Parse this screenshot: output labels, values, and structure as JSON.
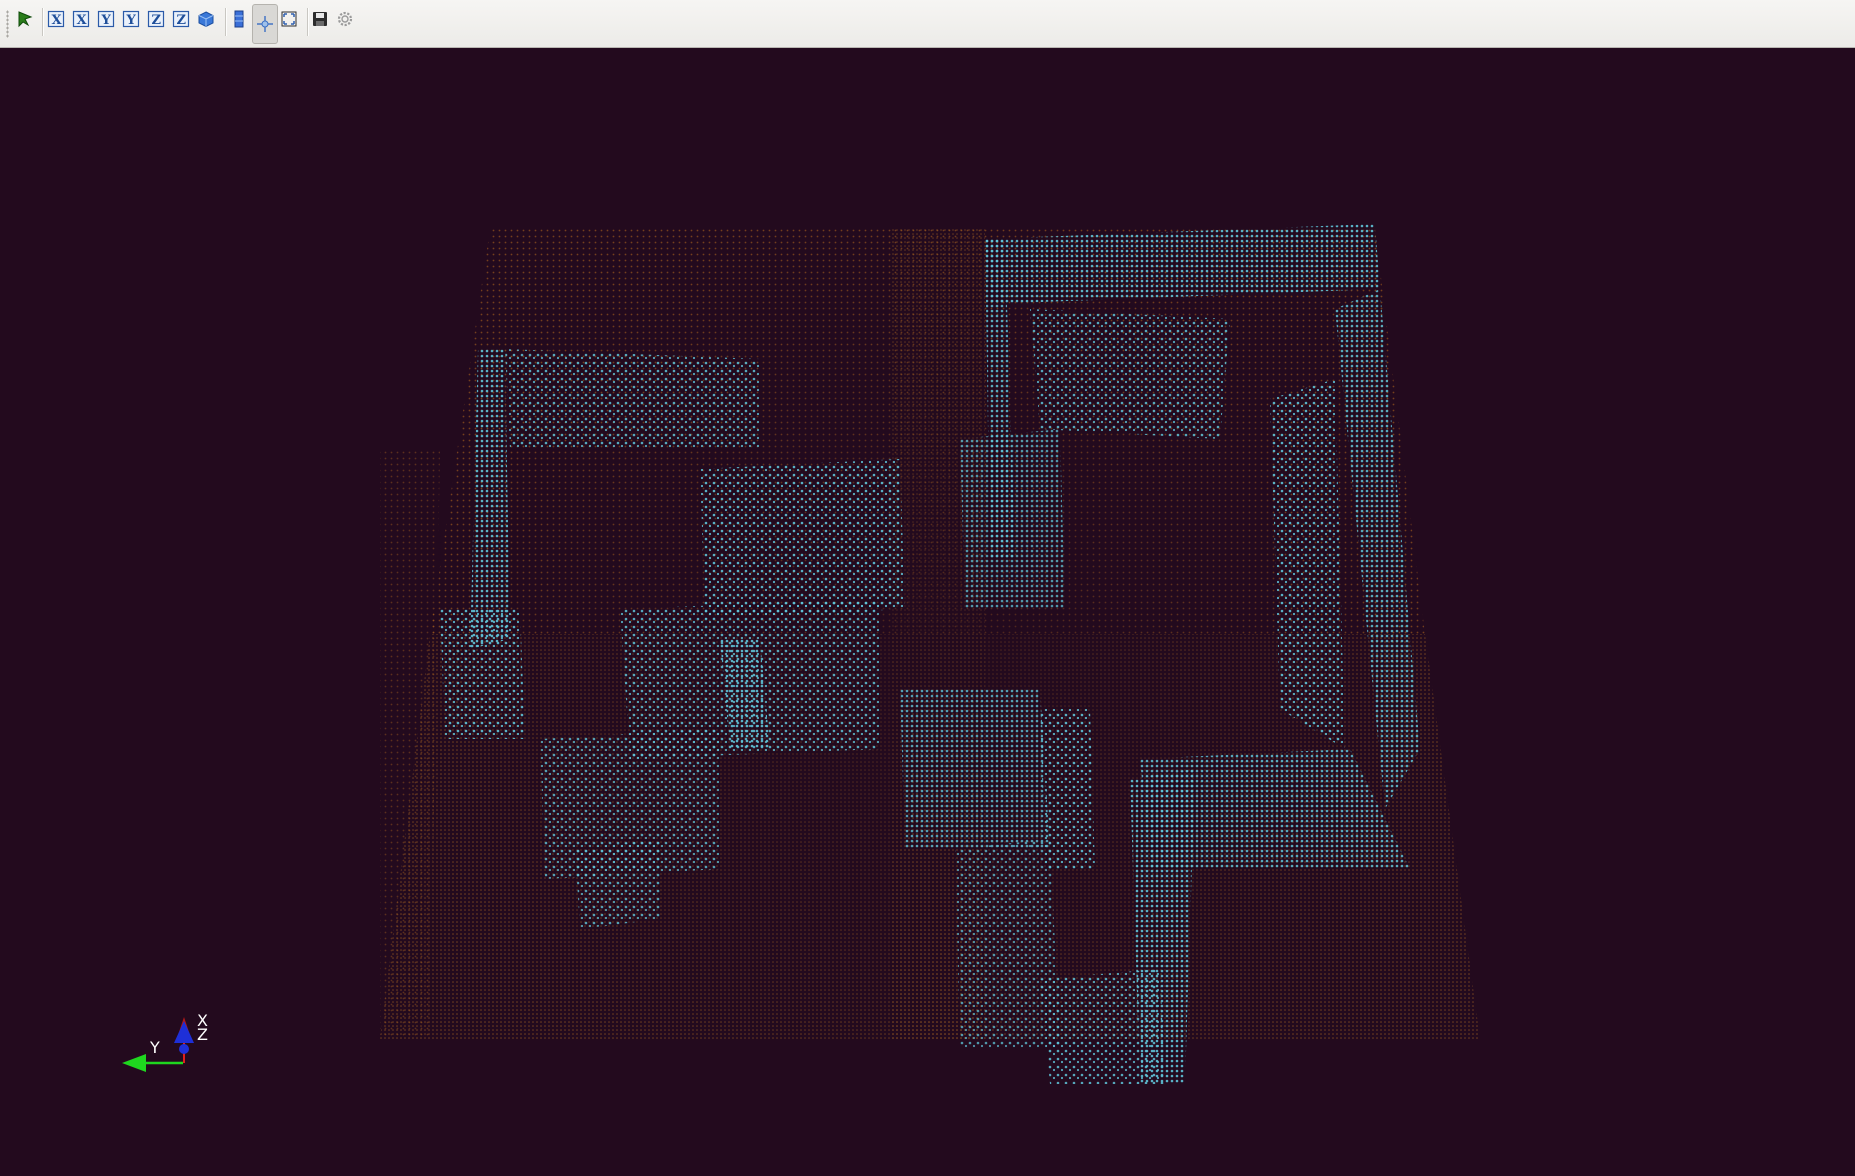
{
  "toolbar": {
    "buttons": [
      {
        "name": "select-icon"
      },
      {
        "name": "view-x-pos",
        "letter": "X"
      },
      {
        "name": "view-x-neg",
        "letter": "X"
      },
      {
        "name": "view-y-pos",
        "letter": "Y"
      },
      {
        "name": "view-y-neg",
        "letter": "Y"
      },
      {
        "name": "view-z-pos",
        "letter": "Z"
      },
      {
        "name": "view-z-neg",
        "letter": "Z"
      },
      {
        "name": "isometric-cube-icon"
      },
      {
        "name": "color-legend-icon"
      },
      {
        "name": "rotation-center-icon",
        "active": true
      },
      {
        "name": "fit-view-icon"
      },
      {
        "name": "save-icon"
      },
      {
        "name": "settings-icon"
      }
    ]
  },
  "axes_triad": {
    "x_label": "X",
    "y_label": "Y",
    "z_label": "Z"
  },
  "colors": {
    "background": "#230a1e",
    "occupied_voxels": "#5fc4d9",
    "free_space_voxels": "#b86a1c",
    "x_axis": "#e0201a",
    "y_axis": "#1fd61f",
    "z_axis": "#1e2fd8"
  }
}
